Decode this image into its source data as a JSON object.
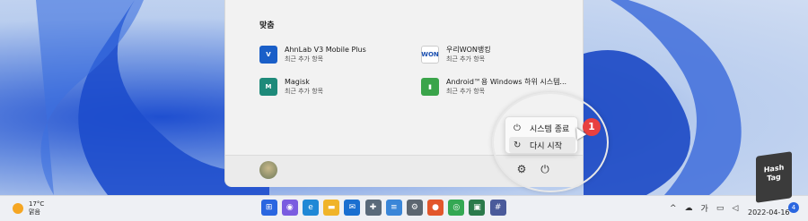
{
  "start_menu": {
    "section_title": "맞춤",
    "apps": [
      {
        "name": "AhnLab V3 Mobile Plus",
        "sub": "최근 추가 항목",
        "icon": "ahnlab-v3-icon",
        "color": "#1a5fc8",
        "glyph": "V"
      },
      {
        "name": "우리WON뱅킹",
        "sub": "최근 추가 항목",
        "icon": "woori-won-icon",
        "color": "#ffffff",
        "glyph": "WON"
      },
      {
        "name": "Magisk",
        "sub": "최근 추가 항목",
        "icon": "magisk-icon",
        "color": "#1e8a7a",
        "glyph": "M"
      },
      {
        "name": "Android™용 Windows 하위 시스템...",
        "sub": "최근 추가 항목",
        "icon": "wsa-icon",
        "color": "#3aa44a",
        "glyph": "▮"
      }
    ]
  },
  "power_menu": {
    "shutdown_label": "시스템 종료",
    "restart_label": "다시 시작"
  },
  "badge_number": "1",
  "weather": {
    "temp": "17°C",
    "condition": "맑음"
  },
  "taskbar_icons": [
    {
      "name": "start-windows-icon",
      "color": "#2a66e0",
      "glyph": "⊞"
    },
    {
      "name": "search-icon",
      "color": "#7a5ce0",
      "glyph": "◉"
    },
    {
      "name": "edge-icon",
      "color": "#1f88d6",
      "glyph": "e"
    },
    {
      "name": "file-explorer-icon",
      "color": "#f0b429",
      "glyph": "▬"
    },
    {
      "name": "mail-icon",
      "color": "#1a6fd0",
      "glyph": "✉"
    },
    {
      "name": "cross-app-icon",
      "color": "#5a6a7a",
      "glyph": "✚"
    },
    {
      "name": "notepad-icon",
      "color": "#3a86d8",
      "glyph": "≡"
    },
    {
      "name": "settings-icon",
      "color": "#5c6670",
      "glyph": "⚙"
    },
    {
      "name": "firefox-icon",
      "color": "#e2562b",
      "glyph": "●"
    },
    {
      "name": "chrome-icon",
      "color": "#34a853",
      "glyph": "◎"
    },
    {
      "name": "store-icon",
      "color": "#2b7a4b",
      "glyph": "▣"
    },
    {
      "name": "calculator-icon",
      "color": "#4a5a9a",
      "glyph": "#"
    }
  ],
  "tray": {
    "ime": "가"
  },
  "clock": {
    "date": "2022-04-16"
  },
  "logo": {
    "line1": "Hash",
    "line2": "Tag"
  },
  "logo_badge": "4"
}
